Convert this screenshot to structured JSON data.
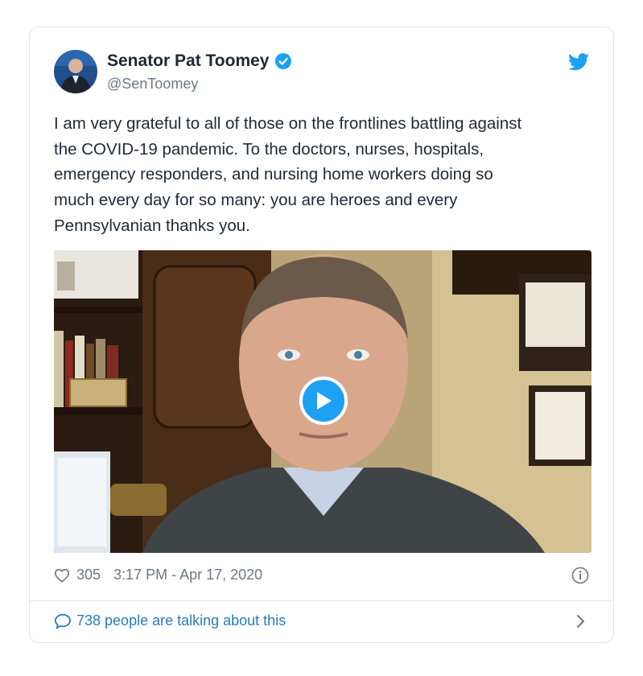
{
  "user": {
    "display_name": "Senator Pat Toomey",
    "handle": "@SenToomey"
  },
  "tweet": {
    "text_lines": [
      "I am very grateful to all of those on the frontlines battling against",
      "the COVID-19 pandemic. To the doctors, nurses, hospitals,",
      "emergency responders, and nursing home workers doing so",
      "much every day for so many: you are heroes and every",
      "Pennsylvanian thanks you."
    ]
  },
  "media": {
    "type": "video",
    "play_icon": "play-icon"
  },
  "meta": {
    "likes": "305",
    "timestamp": "3:17 PM - Apr 17, 2020"
  },
  "conversation": {
    "label": "738 people are talking about this"
  },
  "colors": {
    "accent": "#1da1f2",
    "link": "#2b7bb9",
    "text": "#1c2938",
    "secondary": "#6a7784",
    "border": "#dfe3e7"
  }
}
